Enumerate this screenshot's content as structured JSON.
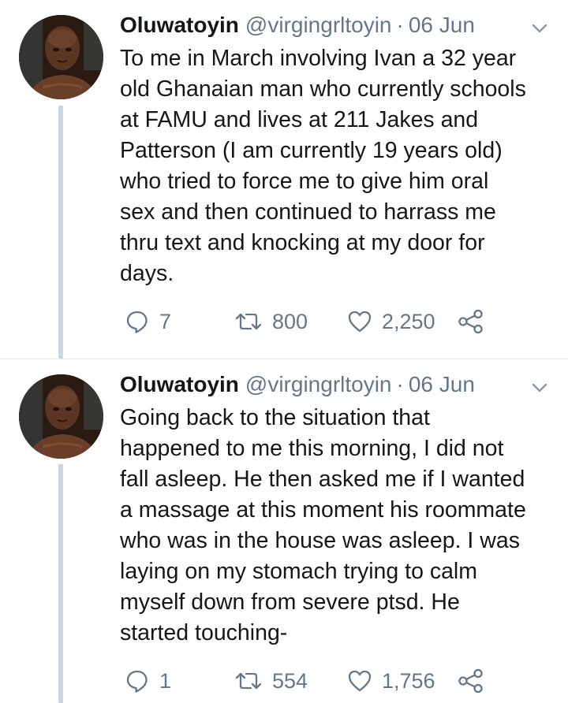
{
  "colors": {
    "text": "#14171a",
    "secondary": "#657786",
    "thread_line": "#ccd6dd",
    "divider": "#e6ecf0"
  },
  "tweets": [
    {
      "author_name": "Oluwatoyin",
      "handle": "@virgingrltoyin",
      "separator": "·",
      "date": "06 Jun",
      "text_lines": [
        "To me in March involving Ivan a 32 year",
        "old Ghanaian man who currently schools",
        "at FAMU and lives at 211 Jakes and",
        "Patterson (I am currently 19 years old)",
        "who tried to force me to give him oral",
        "sex and then continued to harrass me",
        "thru text and knocking at my door for",
        "days."
      ],
      "replies": "7",
      "retweets": "800",
      "likes": "2,250",
      "icons": {
        "avatar": "profile-photo",
        "menu": "chevron-down-icon",
        "reply": "reply-bubble-icon",
        "retweet": "retweet-icon",
        "like": "heart-icon",
        "share": "share-icon"
      }
    },
    {
      "author_name": "Oluwatoyin",
      "handle": "@virgingrltoyin",
      "separator": "·",
      "date": "06 Jun",
      "text_lines": [
        "Going back to the situation that",
        "happened to me this morning, I did not",
        "fall asleep. He then asked me if I wanted",
        "a massage at this moment his roommate",
        "who was in the house was asleep. I was",
        "laying on my stomach trying to calm",
        "myself down from severe ptsd. He",
        "started touching-"
      ],
      "replies": "1",
      "retweets": "554",
      "likes": "1,756",
      "icons": {
        "avatar": "profile-photo",
        "menu": "chevron-down-icon",
        "reply": "reply-bubble-icon",
        "retweet": "retweet-icon",
        "like": "heart-icon",
        "share": "share-icon"
      }
    }
  ]
}
